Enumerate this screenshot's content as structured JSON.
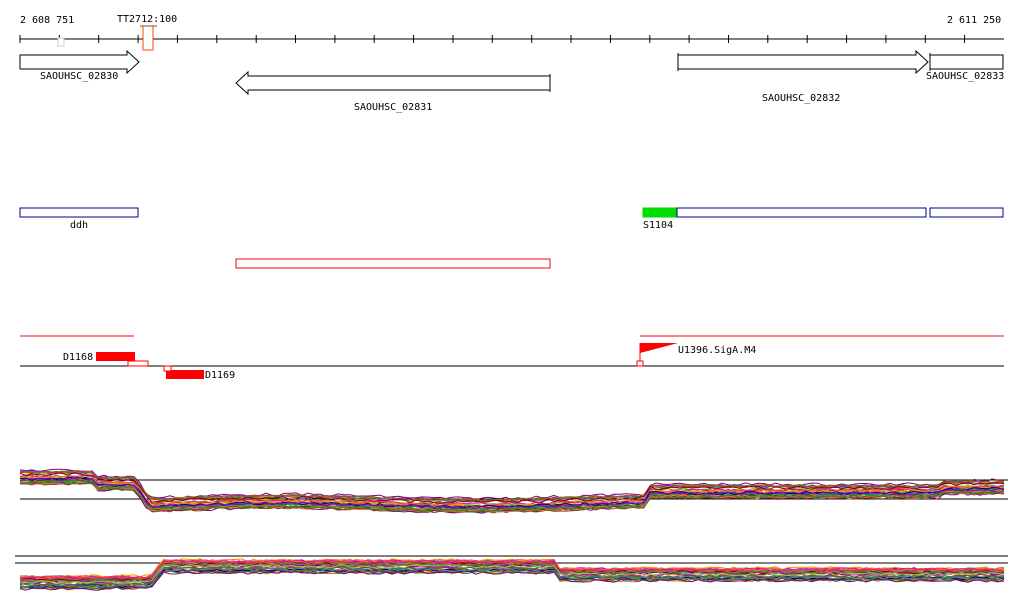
{
  "ruler": {
    "start_label": "2 608 751",
    "end_label": "2 611 250",
    "marker_label": "TT2712:100"
  },
  "genes": [
    {
      "name": "SAOUHSC_02830",
      "strand": "+"
    },
    {
      "name": "SAOUHSC_02831",
      "strand": "-"
    },
    {
      "name": "SAOUHSC_02832",
      "strand": "+"
    },
    {
      "name": "SAOUHSC_02833",
      "strand": "+"
    }
  ],
  "operons": [
    {
      "name": "ddh"
    },
    {
      "name": "S1104"
    }
  ],
  "regulatory": [
    {
      "name": "D1168"
    },
    {
      "name": "D1169"
    },
    {
      "name": "U1396.SigA.M4"
    }
  ],
  "colors": {
    "gene_outline": "#000000",
    "operon_outline": "#00008b",
    "operon_highlight": "#00dd00",
    "feature_red": "#ff0000",
    "expression_lines": [
      "#8b0000",
      "#228b22",
      "#6b8e23",
      "#9acd32",
      "#800080",
      "#ff1493",
      "#4682b4",
      "#b8860b",
      "#ff8c00",
      "#2e8b57",
      "#8b4513",
      "#ff6347",
      "#000080",
      "#556b2f",
      "#a0522d",
      "#9400d3"
    ]
  }
}
